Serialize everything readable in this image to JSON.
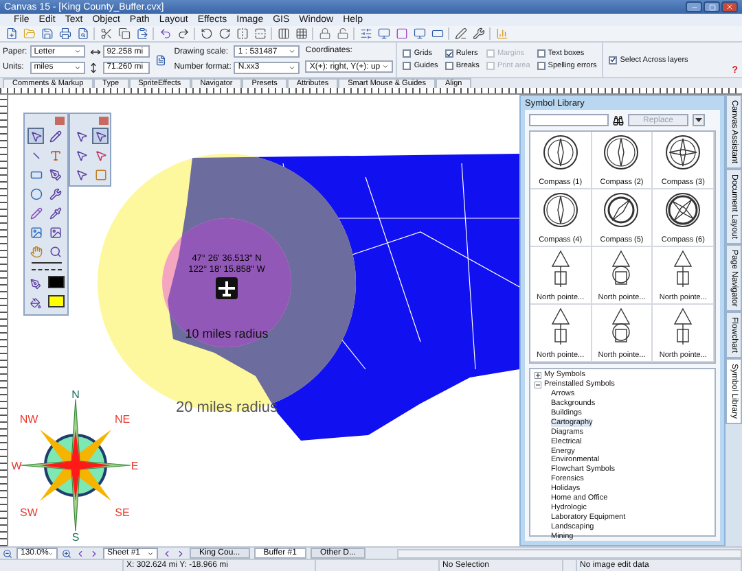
{
  "window": {
    "title": "Canvas 15 - [King County_Buffer.cvx]"
  },
  "menu": [
    "File",
    "Edit",
    "Text",
    "Object",
    "Path",
    "Layout",
    "Effects",
    "Image",
    "GIS",
    "Window",
    "Help"
  ],
  "properties": {
    "paper": {
      "label": "Paper:",
      "value": "Letter"
    },
    "units": {
      "label": "Units:",
      "value": "miles"
    },
    "width": "92.258 mi",
    "height": "71.260 mi",
    "drawing_scale": {
      "label": "Drawing scale:",
      "value": "1 : 531487"
    },
    "number_format": {
      "label": "Number format:",
      "value": "N.xx3"
    },
    "coordinates": {
      "label": "Coordinates:",
      "value": "X(+): right, Y(+): up"
    },
    "checkboxes": [
      {
        "label": "Grids",
        "checked": false,
        "disabled": false
      },
      {
        "label": "Rulers",
        "checked": true,
        "disabled": false
      },
      {
        "label": "Margins",
        "checked": false,
        "disabled": true
      },
      {
        "label": "Text boxes",
        "checked": false,
        "disabled": false
      },
      {
        "label": "Guides",
        "checked": false,
        "disabled": false
      },
      {
        "label": "Breaks",
        "checked": false,
        "disabled": false
      },
      {
        "label": "Print area",
        "checked": false,
        "disabled": true
      },
      {
        "label": "Spelling errors",
        "checked": false,
        "disabled": false
      }
    ],
    "select_across": {
      "label": "Select Across layers",
      "checked": true
    },
    "help": "?"
  },
  "tabs": [
    {
      "label": "Comments & Markup",
      "selected": false
    },
    {
      "label": "Type",
      "selected": false
    },
    {
      "label": "SpriteEffects",
      "selected": false
    },
    {
      "label": "Navigator",
      "selected": false
    },
    {
      "label": "Presets",
      "selected": false
    },
    {
      "label": "Attributes",
      "selected": false
    },
    {
      "label": "Smart Mouse & Guides",
      "selected": false
    },
    {
      "label": "Align",
      "selected": false
    }
  ],
  "palette": {
    "swatches": [
      {
        "kind": "stroke",
        "color": "#000000"
      },
      {
        "kind": "fill",
        "color": "#ffff00"
      }
    ]
  },
  "map": {
    "coordinates": [
      "47° 26' 36.513\" N",
      "122° 18' 15.858\" W"
    ],
    "inner_label": "10 miles radius",
    "outer_label": "20 miles radius"
  },
  "compass": {
    "labels": [
      "N",
      "NW",
      "NE",
      "W",
      "E",
      "SW",
      "SE",
      "S"
    ]
  },
  "symbol_library": {
    "title": "Symbol Library",
    "replace": {
      "label": "Replace",
      "disabled": true
    },
    "symbols": [
      {
        "caption": "Compass (1)",
        "kind": "compass"
      },
      {
        "caption": "Compass (2)",
        "kind": "compass"
      },
      {
        "caption": "Compass (3)",
        "kind": "compass"
      },
      {
        "caption": "Compass (4)",
        "kind": "compass"
      },
      {
        "caption": "Compass (5)",
        "kind": "compass"
      },
      {
        "caption": "Compass (6)",
        "kind": "compass"
      },
      {
        "caption": "North pointe...",
        "kind": "pointer"
      },
      {
        "caption": "North pointe...",
        "kind": "pointer"
      },
      {
        "caption": "North pointe...",
        "kind": "pointer"
      },
      {
        "caption": "North pointe...",
        "kind": "pointer"
      },
      {
        "caption": "North pointe...",
        "kind": "pointer"
      },
      {
        "caption": "North pointe...",
        "kind": "pointer"
      }
    ],
    "tree": [
      {
        "label": "My Symbols",
        "expanded": false,
        "selected": false
      },
      {
        "label": "Preinstalled Symbols",
        "expanded": true,
        "selected": false,
        "children": [
          {
            "label": "Arrows",
            "selected": false
          },
          {
            "label": "Backgrounds",
            "selected": false
          },
          {
            "label": "Buildings",
            "selected": false
          },
          {
            "label": "Cartography",
            "selected": true
          },
          {
            "label": "Diagrams",
            "selected": false
          },
          {
            "label": "Electrical",
            "selected": false
          },
          {
            "label": "Energy",
            "selected": false
          },
          {
            "label": "Environmental",
            "selected": false
          },
          {
            "label": "Flowchart Symbols",
            "selected": false
          },
          {
            "label": "Forensics",
            "selected": false
          },
          {
            "label": "Holidays",
            "selected": false
          },
          {
            "label": "Home and Office",
            "selected": false
          },
          {
            "label": "Hydrologic",
            "selected": false
          },
          {
            "label": "Laboratory Equipment",
            "selected": false
          },
          {
            "label": "Landscaping",
            "selected": false
          },
          {
            "label": "Mining",
            "selected": false
          }
        ]
      }
    ]
  },
  "side_tabs": [
    {
      "label": "Canvas Assistant",
      "selected": false
    },
    {
      "label": "Document Layout",
      "selected": false
    },
    {
      "label": "Page Navigator",
      "selected": false
    },
    {
      "label": "Flowchart",
      "selected": false
    },
    {
      "label": "Symbol Library",
      "selected": true
    }
  ],
  "bottom": {
    "zoom": "130.0%",
    "sheet": "Sheet #1",
    "doc_tabs": [
      {
        "label": "King Cou...",
        "selected": false
      },
      {
        "label": "Buffer #1",
        "selected": true
      },
      {
        "label": "Other D...",
        "selected": false
      }
    ]
  },
  "status": [
    "X: 302.624 mi Y: -18.966 mi",
    "No Selection",
    "No image edit data"
  ]
}
